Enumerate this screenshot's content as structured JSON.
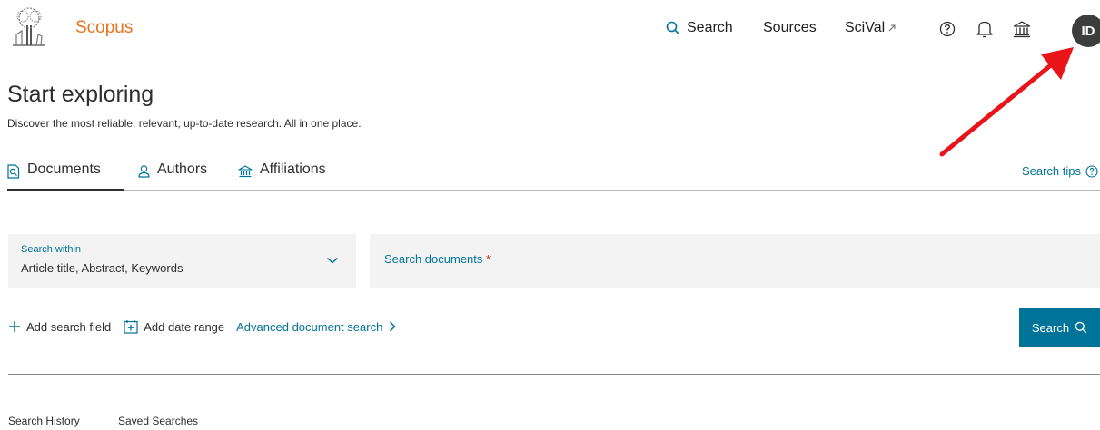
{
  "header": {
    "brand": "Scopus",
    "nav": {
      "search": "Search",
      "sources": "Sources",
      "scival": "SciVal"
    },
    "avatar_initials": "ID"
  },
  "intro": {
    "title": "Start exploring",
    "subtitle": "Discover the most reliable, relevant, up-to-date research. All in one place."
  },
  "tabs": [
    {
      "label": "Documents",
      "active": true
    },
    {
      "label": "Authors",
      "active": false
    },
    {
      "label": "Affiliations",
      "active": false
    }
  ],
  "search_tips": "Search tips",
  "search_within": {
    "label": "Search within",
    "value": "Article title, Abstract, Keywords"
  },
  "search_documents": {
    "placeholder": "Search documents",
    "required_mark": "*"
  },
  "actions": {
    "add_field": "Add search field",
    "add_date": "Add date range",
    "advanced": "Advanced document search"
  },
  "search_button": "Search",
  "footer_tabs": {
    "history": "Search History",
    "saved": "Saved Searches"
  },
  "colors": {
    "brand": "#e9711c",
    "link": "#007398",
    "annotation": "#e8141a"
  }
}
